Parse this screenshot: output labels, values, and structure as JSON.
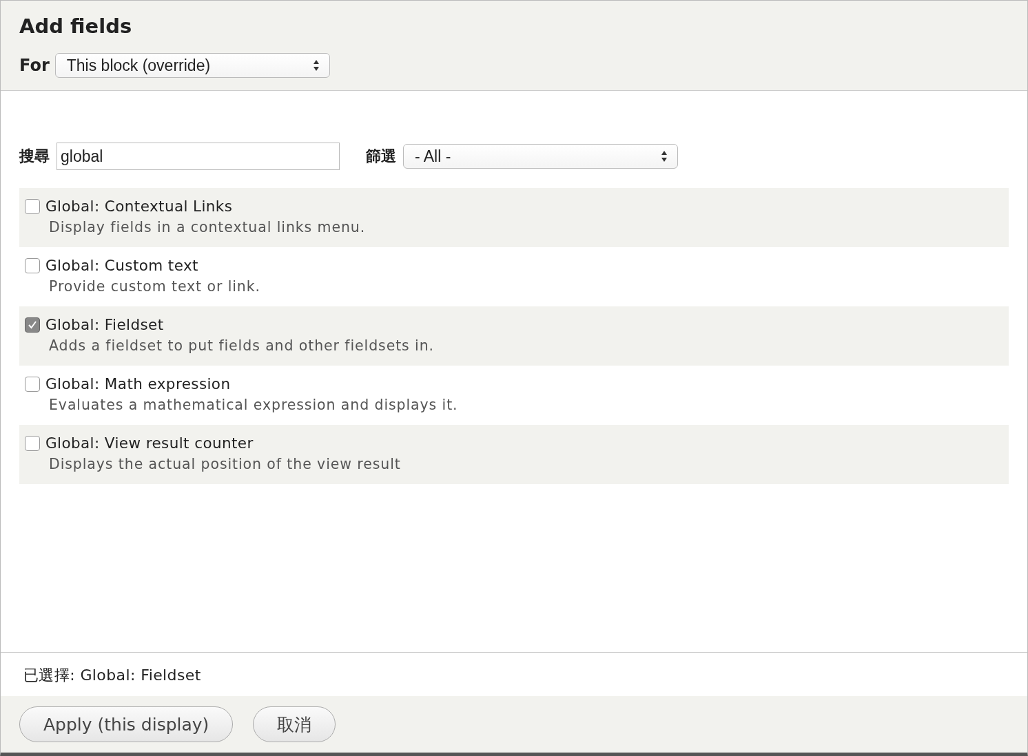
{
  "header": {
    "title": "Add fields",
    "for_label": "For",
    "for_select": "This block (override)"
  },
  "search": {
    "label": "搜尋",
    "value": "global"
  },
  "filter": {
    "label": "篩選",
    "value": "- All -"
  },
  "fields": [
    {
      "name": "Global: Contextual Links",
      "description": "Display fields in a contextual links menu.",
      "checked": false
    },
    {
      "name": "Global: Custom text",
      "description": "Provide custom text or link.",
      "checked": false
    },
    {
      "name": "Global: Fieldset",
      "description": "Adds a fieldset to put fields and other fieldsets in.",
      "checked": true
    },
    {
      "name": "Global: Math expression",
      "description": "Evaluates a mathematical expression and displays it.",
      "checked": false
    },
    {
      "name": "Global: View result counter",
      "description": "Displays the actual position of the view result",
      "checked": false
    }
  ],
  "selected_summary": "已選擇: Global: Fieldset",
  "buttons": [
    "Apply (this display)",
    "取消"
  ]
}
